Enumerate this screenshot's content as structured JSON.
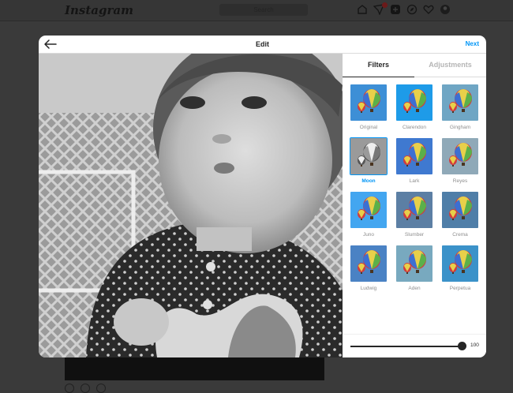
{
  "background": {
    "logo": "Instagram",
    "search_placeholder": "Search"
  },
  "modal": {
    "title": "Edit",
    "next_label": "Next",
    "tabs": [
      {
        "label": "Filters",
        "active": true
      },
      {
        "label": "Adjustments",
        "active": false
      }
    ],
    "filters": [
      {
        "label": "Original",
        "tone": "#3d8fd6"
      },
      {
        "label": "Clarendon",
        "tone": "#1e9be8"
      },
      {
        "label": "Gingham",
        "tone": "#6fa6c4"
      },
      {
        "label": "Moon",
        "tone": "#9a9a9a"
      },
      {
        "label": "Lark",
        "tone": "#3f79d0"
      },
      {
        "label": "Reyes",
        "tone": "#8fa9b8"
      },
      {
        "label": "Juno",
        "tone": "#43a6f0"
      },
      {
        "label": "Slumber",
        "tone": "#5c7fa4"
      },
      {
        "label": "Crema",
        "tone": "#4f7ea8"
      },
      {
        "label": "Ludwig",
        "tone": "#4a82c4"
      },
      {
        "label": "Aden",
        "tone": "#78a9bf"
      },
      {
        "label": "Perpetua",
        "tone": "#3b92c9"
      }
    ],
    "selected_filter": "Moon",
    "intensity": 100,
    "intensity_label": "100"
  },
  "colors": {
    "accent": "#0095f6",
    "text": "#262626",
    "muted": "#8e8e8e"
  }
}
